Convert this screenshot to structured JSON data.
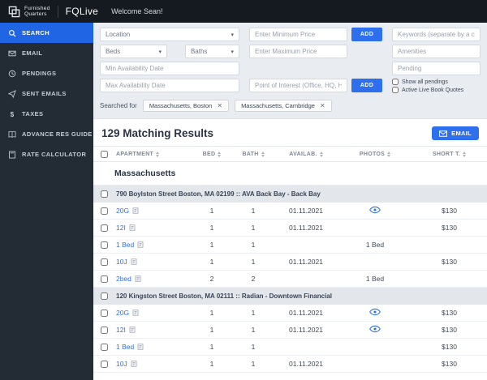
{
  "colors": {
    "accent": "#2e6fed",
    "topbar": "#151a21",
    "sidebar": "#232b35"
  },
  "topbar": {
    "brand_line1": "Furnished",
    "brand_line2": "Quarters",
    "app_name": "FQLive",
    "welcome": "Welcome Sean!"
  },
  "sidebar": {
    "items": [
      {
        "label": "SEARCH",
        "icon": "search-icon",
        "active": true
      },
      {
        "label": "EMAIL",
        "icon": "email-icon",
        "active": false
      },
      {
        "label": "PENDINGS",
        "icon": "pendings-icon",
        "active": false
      },
      {
        "label": "SENT EMAILS",
        "icon": "sent-emails-icon",
        "active": false
      },
      {
        "label": "TAXES",
        "icon": "taxes-icon",
        "active": false
      },
      {
        "label": "ADVANCE RES GUIDE",
        "icon": "guide-icon",
        "active": false
      },
      {
        "label": "RATE CALCULATOR",
        "icon": "calculator-icon",
        "active": false
      }
    ]
  },
  "filters": {
    "location_placeholder": "Location",
    "beds_label": "Beds",
    "baths_label": "Baths",
    "min_avail_placeholder": "Min Availability Date",
    "max_avail_placeholder": "Max Availability Date",
    "min_price_placeholder": "Enter Minimum Price",
    "max_price_placeholder": "Enter Maximum Price",
    "poi_placeholder": "Point of Interest (Office, HQ, Hospital)",
    "add_button": "ADD",
    "keywords_placeholder": "Keywords (separate by a comma)",
    "amenities_placeholder": "Amenities",
    "pending_placeholder": "Pending",
    "checkbox_show_all_pendings": "Show all pendings",
    "checkbox_active_quotes": "Active Live Book Quotes"
  },
  "searched_for": {
    "label": "Searched for",
    "tags": [
      {
        "text": "Massachusetts, Boston"
      },
      {
        "text": "Massachusetts, Cambridge"
      }
    ]
  },
  "results": {
    "title": "129 Matching Results",
    "email_button": "EMAIL",
    "columns": [
      "APARTMENT",
      "BED",
      "BATH",
      "AVAILAB.",
      "PHOTOS",
      "SHORT T."
    ],
    "state_group": "Massachusetts",
    "buildings": [
      {
        "name": "790 Boylston Street Boston, MA 02199 :: AVA Back Bay - Back Bay",
        "units": [
          {
            "name": "20G",
            "bed": "1",
            "bath": "1",
            "avail": "01.11.2021",
            "photos": "",
            "short": "$130"
          },
          {
            "name": "12I",
            "bed": "1",
            "bath": "1",
            "avail": "01.11.2021",
            "photos": "",
            "short": "$130"
          },
          {
            "name": "1 Bed",
            "bed": "1",
            "bath": "1",
            "avail": "",
            "photos": "1 Bed",
            "short": ""
          },
          {
            "name": "10J",
            "bed": "1",
            "bath": "1",
            "avail": "01.11.2021",
            "photos": "",
            "short": "$130"
          },
          {
            "name": "2bed",
            "bed": "2",
            "bath": "2",
            "avail": "",
            "photos": "1 Bed",
            "short": ""
          }
        ]
      },
      {
        "name": "120 Kingston Street Boston, MA 02111 :: Radian - Downtown Financial",
        "units": [
          {
            "name": "20G",
            "bed": "1",
            "bath": "1",
            "avail": "01.11.2021",
            "photos": "",
            "short": "$130"
          },
          {
            "name": "12I",
            "bed": "1",
            "bath": "1",
            "avail": "01.11.2021",
            "photos": "",
            "short": "$130"
          },
          {
            "name": "1 Bed",
            "bed": "1",
            "bath": "1",
            "avail": "",
            "photos": "",
            "short": "$130"
          },
          {
            "name": "10J",
            "bed": "1",
            "bath": "1",
            "avail": "01.11.2021",
            "photos": "",
            "short": "$130"
          }
        ]
      }
    ]
  }
}
